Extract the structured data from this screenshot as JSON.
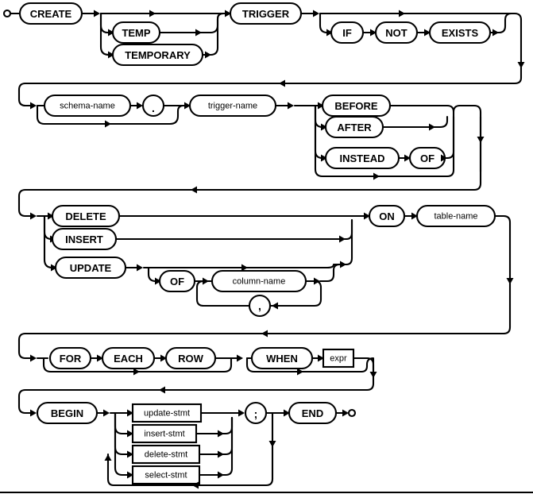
{
  "diagram": {
    "title": "create-trigger-stmt",
    "kind": "railroad-syntax-diagram",
    "stroke_color": "#000000",
    "fill_color": "#ffffff",
    "background": "#ffffff",
    "rows": [
      {
        "id": "row-1",
        "nodes": [
          {
            "id": "n-create",
            "label": "CREATE",
            "shape": "terminal"
          },
          {
            "id": "n-temp",
            "label": "TEMP",
            "shape": "terminal"
          },
          {
            "id": "n-temporary",
            "label": "TEMPORARY",
            "shape": "terminal"
          },
          {
            "id": "n-trigger",
            "label": "TRIGGER",
            "shape": "terminal"
          },
          {
            "id": "n-if",
            "label": "IF",
            "shape": "terminal"
          },
          {
            "id": "n-not",
            "label": "NOT",
            "shape": "terminal"
          },
          {
            "id": "n-exists",
            "label": "EXISTS",
            "shape": "terminal"
          }
        ]
      },
      {
        "id": "row-2",
        "nodes": [
          {
            "id": "n-schema-name",
            "label": "schema-name",
            "shape": "nonterminal"
          },
          {
            "id": "n-dot",
            "label": ".",
            "shape": "circle-terminal"
          },
          {
            "id": "n-trigger-name",
            "label": "trigger-name",
            "shape": "nonterminal"
          },
          {
            "id": "n-before",
            "label": "BEFORE",
            "shape": "terminal"
          },
          {
            "id": "n-after",
            "label": "AFTER",
            "shape": "terminal"
          },
          {
            "id": "n-instead",
            "label": "INSTEAD",
            "shape": "terminal"
          },
          {
            "id": "n-of-1",
            "label": "OF",
            "shape": "terminal"
          }
        ]
      },
      {
        "id": "row-3",
        "nodes": [
          {
            "id": "n-delete",
            "label": "DELETE",
            "shape": "terminal"
          },
          {
            "id": "n-insert",
            "label": "INSERT",
            "shape": "terminal"
          },
          {
            "id": "n-update",
            "label": "UPDATE",
            "shape": "terminal"
          },
          {
            "id": "n-of-2",
            "label": "OF",
            "shape": "terminal"
          },
          {
            "id": "n-column-name",
            "label": "column-name",
            "shape": "nonterminal"
          },
          {
            "id": "n-comma",
            "label": ",",
            "shape": "circle-terminal"
          },
          {
            "id": "n-on",
            "label": "ON",
            "shape": "terminal"
          },
          {
            "id": "n-table-name",
            "label": "table-name",
            "shape": "nonterminal"
          }
        ]
      },
      {
        "id": "row-4",
        "nodes": [
          {
            "id": "n-for",
            "label": "FOR",
            "shape": "terminal"
          },
          {
            "id": "n-each",
            "label": "EACH",
            "shape": "terminal"
          },
          {
            "id": "n-row",
            "label": "ROW",
            "shape": "terminal"
          },
          {
            "id": "n-when",
            "label": "WHEN",
            "shape": "terminal"
          },
          {
            "id": "n-expr",
            "label": "expr",
            "shape": "rect-nonterminal"
          }
        ]
      },
      {
        "id": "row-5",
        "nodes": [
          {
            "id": "n-begin",
            "label": "BEGIN",
            "shape": "terminal"
          },
          {
            "id": "n-update-stmt",
            "label": "update-stmt",
            "shape": "rect-nonterminal"
          },
          {
            "id": "n-insert-stmt",
            "label": "insert-stmt",
            "shape": "rect-nonterminal"
          },
          {
            "id": "n-delete-stmt",
            "label": "delete-stmt",
            "shape": "rect-nonterminal"
          },
          {
            "id": "n-select-stmt",
            "label": "select-stmt",
            "shape": "rect-nonterminal"
          },
          {
            "id": "n-semicolon",
            "label": ";",
            "shape": "circle-terminal"
          },
          {
            "id": "n-end",
            "label": "END",
            "shape": "terminal"
          }
        ]
      }
    ],
    "labels": {
      "create": "CREATE",
      "temp": "TEMP",
      "temporary": "TEMPORARY",
      "trigger": "TRIGGER",
      "if": "IF",
      "not": "NOT",
      "exists": "EXISTS",
      "schema_name": "schema-name",
      "dot": ".",
      "trigger_name": "trigger-name",
      "before": "BEFORE",
      "after": "AFTER",
      "instead": "INSTEAD",
      "of_1": "OF",
      "delete": "DELETE",
      "insert": "INSERT",
      "update": "UPDATE",
      "of_2": "OF",
      "column_name": "column-name",
      "comma": ",",
      "on": "ON",
      "table_name": "table-name",
      "for": "FOR",
      "each": "EACH",
      "row": "ROW",
      "when": "WHEN",
      "expr": "expr",
      "begin": "BEGIN",
      "update_stmt": "update-stmt",
      "insert_stmt": "insert-stmt",
      "delete_stmt": "delete-stmt",
      "select_stmt": "select-stmt",
      "semicolon": ";",
      "end": "END"
    }
  }
}
